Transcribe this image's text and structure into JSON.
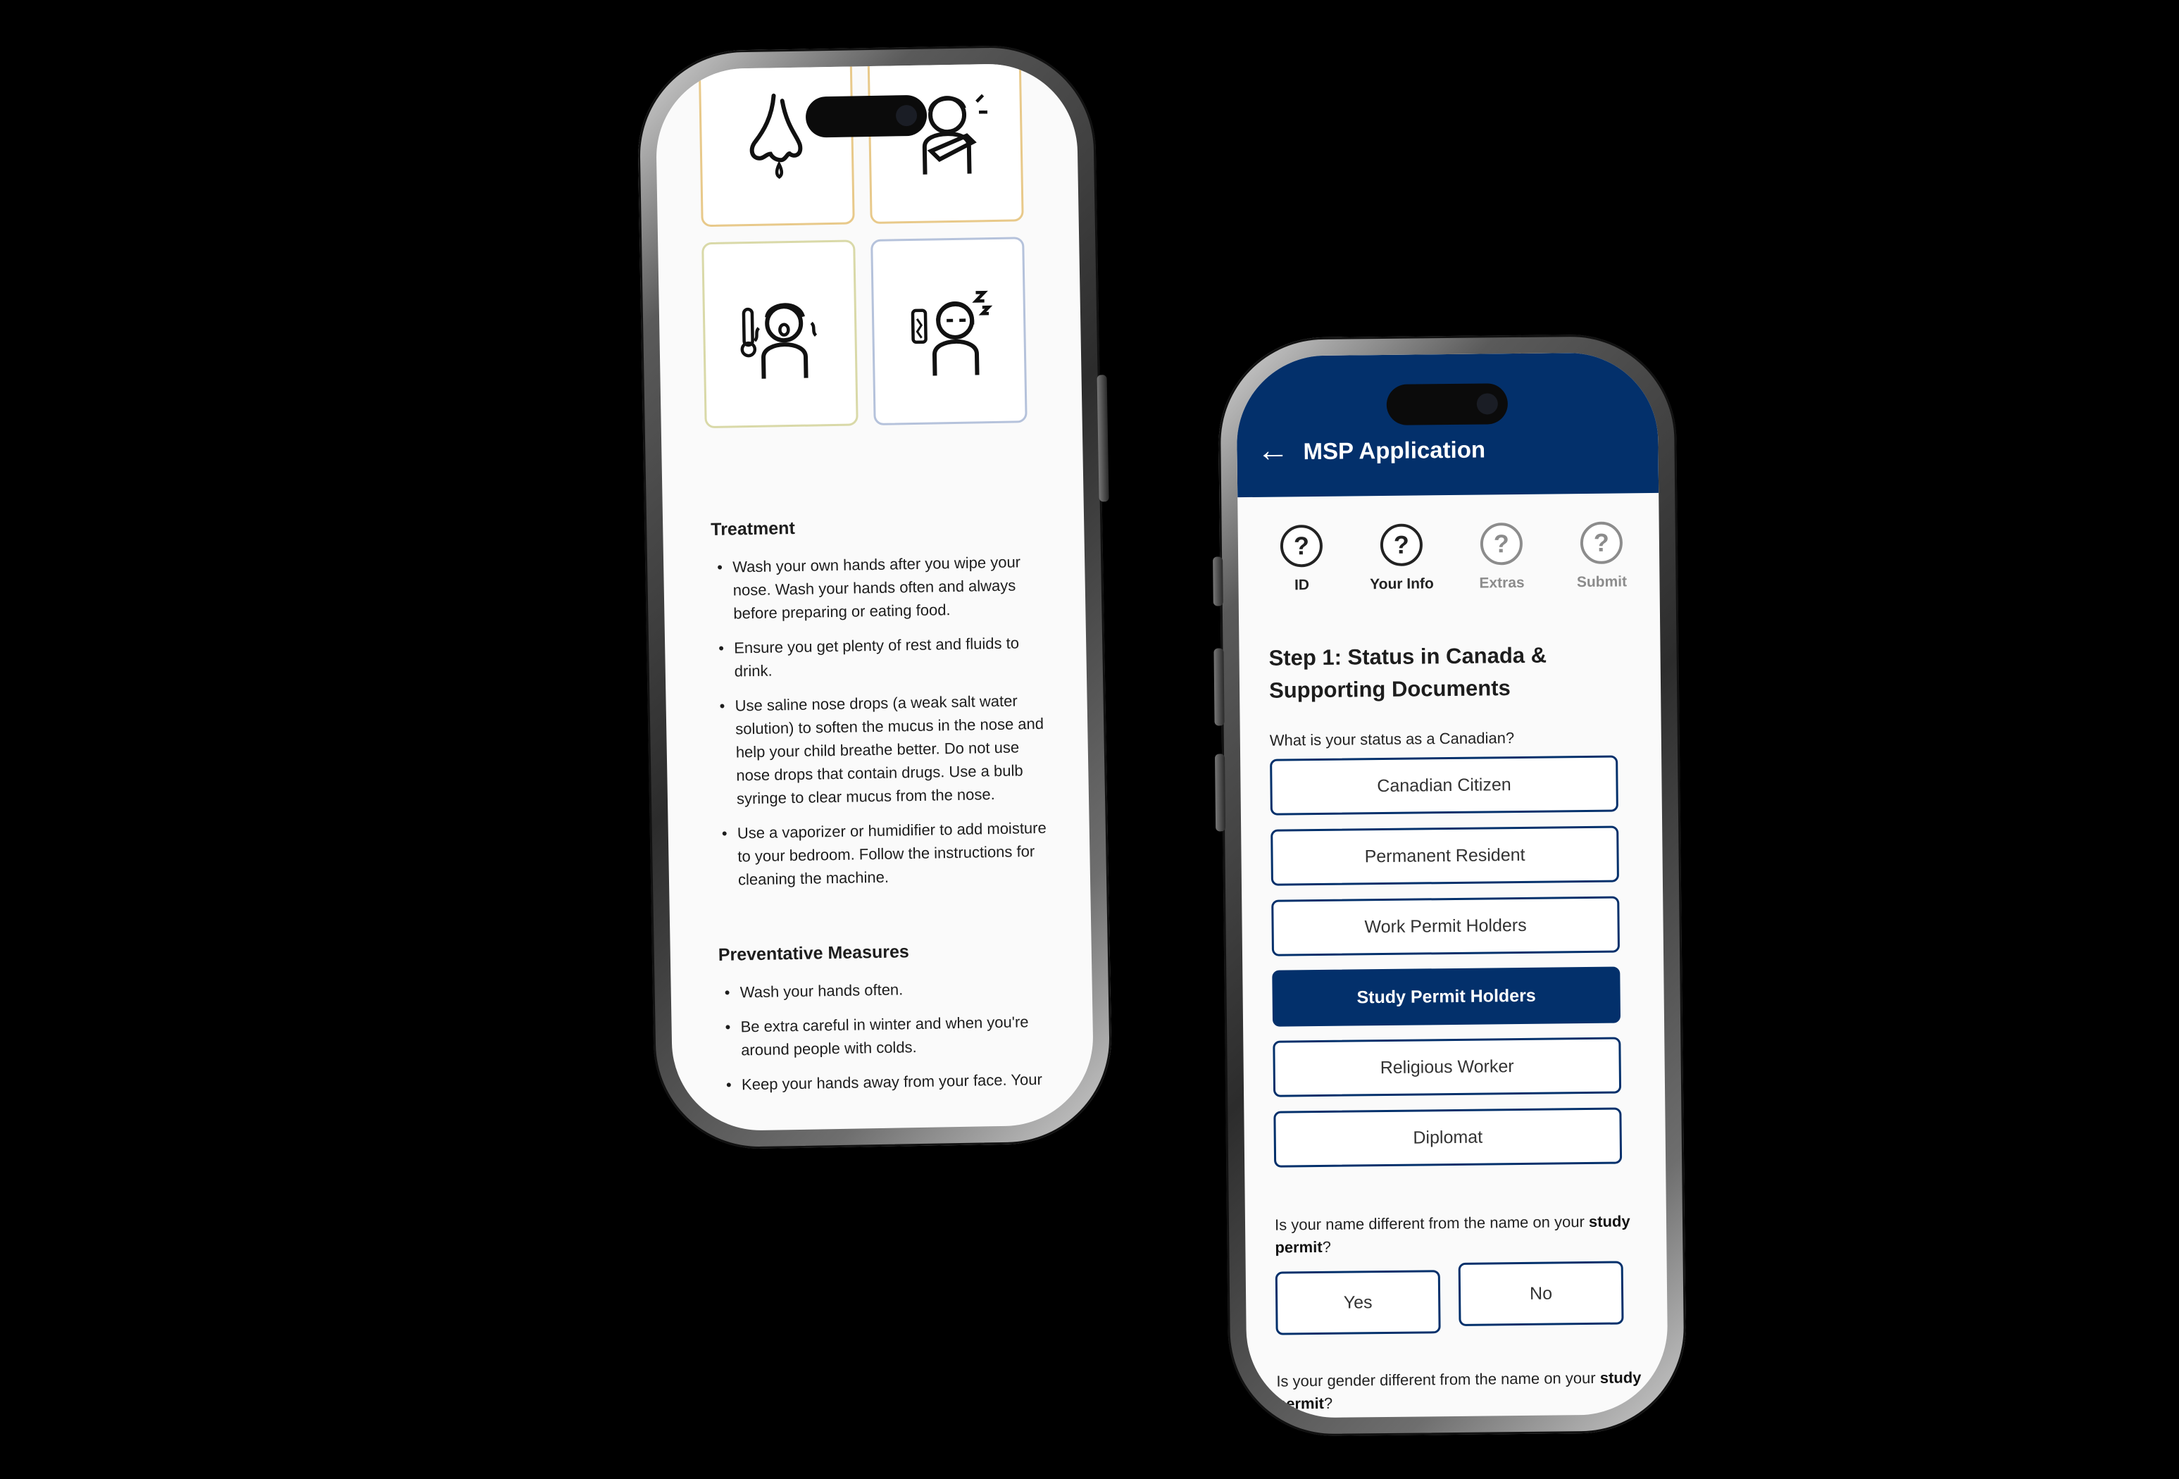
{
  "phone1": {
    "icons": [
      "runny-nose-icon",
      "sneezing-person-icon",
      "fever-child-icon",
      "tired-person-icon"
    ],
    "treatment": {
      "heading": "Treatment",
      "items": [
        "Wash your own hands after you wipe your nose. Wash your hands often and always before preparing or eating food.",
        "Ensure you get plenty of rest and fluids to drink.",
        "Use saline nose drops (a weak salt water solution) to soften the mucus in the nose and help your child breathe better. Do not use nose drops that contain drugs. Use a bulb syringe to clear mucus from the nose.",
        "Use a vaporizer or humidifier to add moisture to your bedroom. Follow the instructions for cleaning the machine."
      ]
    },
    "preventative": {
      "heading": "Preventative Measures",
      "items": [
        "Wash your hands often.",
        "Be extra careful in winter and when you're around people with colds.",
        "Keep your hands away from your face. Your"
      ]
    }
  },
  "phone2": {
    "header": {
      "title": "MSP Application",
      "accent": "#03306b"
    },
    "steps": [
      {
        "label": "ID",
        "state": "active"
      },
      {
        "label": "Your Info",
        "state": "active"
      },
      {
        "label": "Extras",
        "state": "inactive"
      },
      {
        "label": "Submit",
        "state": "inactive"
      }
    ],
    "step_title": "Step 1: Status in Canada & Supporting Documents",
    "status_question": "What is your status as a Canadian?",
    "status_options": [
      "Canadian Citizen",
      "Permanent Resident",
      "Work Permit Holders",
      "Study Permit Holders",
      "Religious Worker",
      "Diplomat"
    ],
    "selected_status": "Study Permit Holders",
    "name_question": {
      "prefix": "Is your name different from the name on your",
      "bold": "study permit",
      "suffix": "?"
    },
    "yes_label": "Yes",
    "no_label": "No",
    "gender_question": {
      "prefix": "Is your gender different from the name on your",
      "bold": "study permit",
      "suffix": "?"
    }
  }
}
